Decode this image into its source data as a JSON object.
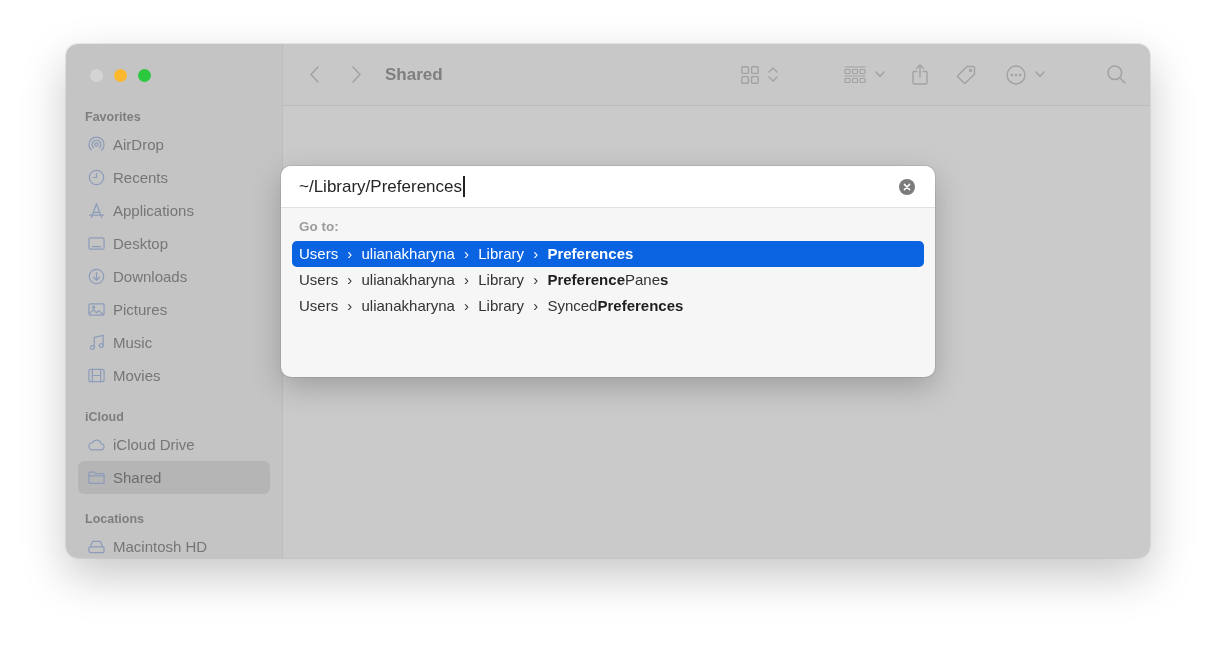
{
  "window": {
    "controls": [
      {
        "color": "#d4d4d4"
      },
      {
        "color": "#fbb82e"
      },
      {
        "color": "#2bc840"
      }
    ]
  },
  "sidebar": {
    "sections": [
      {
        "heading": "Favorites",
        "items": [
          {
            "label": "AirDrop",
            "selected": false
          },
          {
            "label": "Recents",
            "selected": false
          },
          {
            "label": "Applications",
            "selected": false
          },
          {
            "label": "Desktop",
            "selected": false
          },
          {
            "label": "Downloads",
            "selected": false
          },
          {
            "label": "Pictures",
            "selected": false
          },
          {
            "label": "Music",
            "selected": false
          },
          {
            "label": "Movies",
            "selected": false
          }
        ]
      },
      {
        "heading": "iCloud",
        "items": [
          {
            "label": "iCloud Drive",
            "selected": false
          },
          {
            "label": "Shared",
            "selected": true
          }
        ]
      },
      {
        "heading": "Locations",
        "items": [
          {
            "label": "Macintosh HD",
            "selected": false
          }
        ]
      }
    ]
  },
  "toolbar": {
    "title": "Shared"
  },
  "go_to_dialog": {
    "field": {
      "value": "~/Library/Preferences"
    },
    "section_label": "Go to:",
    "suggestions": [
      {
        "path": "Users › ulianakharyna › Library › **Preferences**",
        "selected": true
      },
      {
        "path": "Users › ulianakharyna › Library › **Preference**Pane**s**",
        "selected": false
      },
      {
        "path": "Users › ulianakharyna › Library › Synced**Preferences**",
        "selected": false
      }
    ]
  }
}
